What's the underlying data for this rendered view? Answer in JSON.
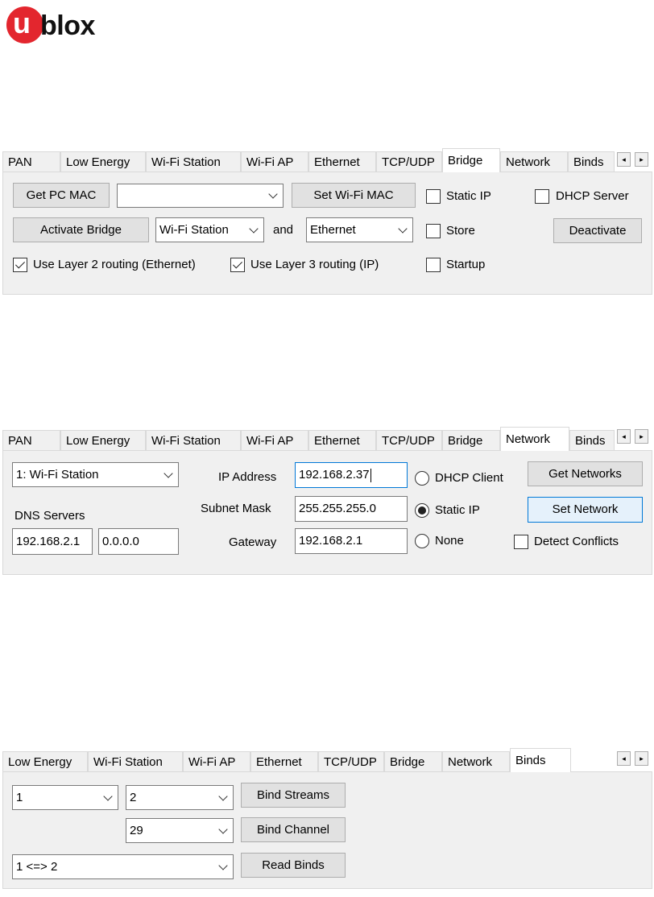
{
  "logo": {
    "mark": "u",
    "text": "blox"
  },
  "bridge_panel": {
    "tabs": [
      "PAN",
      "Low Energy",
      "Wi-Fi Station",
      "Wi-Fi AP",
      "Ethernet",
      "TCP/UDP",
      "Bridge",
      "Network",
      "Binds"
    ],
    "active_tab": "Bridge",
    "get_pc_mac": "Get PC MAC",
    "mac_combo_value": "",
    "set_wifi_mac": "Set Wi-Fi MAC",
    "static_ip": "Static IP",
    "dhcp_server": "DHCP Server",
    "activate_bridge": "Activate Bridge",
    "bridge_from": "Wi-Fi Station",
    "and_label": "and",
    "bridge_to": "Ethernet",
    "store": "Store",
    "deactivate": "Deactivate",
    "layer2": "Use Layer 2 routing (Ethernet)",
    "layer3": "Use Layer 3 routing (IP)",
    "startup": "Startup"
  },
  "network_panel": {
    "tabs": [
      "PAN",
      "Low Energy",
      "Wi-Fi Station",
      "Wi-Fi AP",
      "Ethernet",
      "TCP/UDP",
      "Bridge",
      "Network",
      "Binds"
    ],
    "active_tab": "Network",
    "interface": "1: Wi-Fi Station",
    "ip_address_label": "IP Address",
    "ip_address": "192.168.2.37",
    "dhcp_client": "DHCP Client",
    "get_networks": "Get Networks",
    "dns_servers_label": "DNS Servers",
    "subnet_mask_label": "Subnet Mask",
    "subnet_mask": "255.255.255.0",
    "static_ip": "Static IP",
    "set_network": "Set Network",
    "dns1": "192.168.2.1",
    "dns2": "0.0.0.0",
    "gateway_label": "Gateway",
    "gateway": "192.168.2.1",
    "none": "None",
    "detect_conflicts": "Detect Conflicts"
  },
  "binds_panel": {
    "tabs": [
      "Low Energy",
      "Wi-Fi Station",
      "Wi-Fi AP",
      "Ethernet",
      "TCP/UDP",
      "Bridge",
      "Network",
      "Binds"
    ],
    "active_tab": "Binds",
    "stream_a": "1",
    "stream_b": "2",
    "bind_streams": "Bind Streams",
    "channel": "29",
    "bind_channel": "Bind Channel",
    "binds_list": "1 <=> 2",
    "read_binds": "Read Binds"
  },
  "icons": {
    "scroll_left": "◂",
    "scroll_right": "▸"
  }
}
